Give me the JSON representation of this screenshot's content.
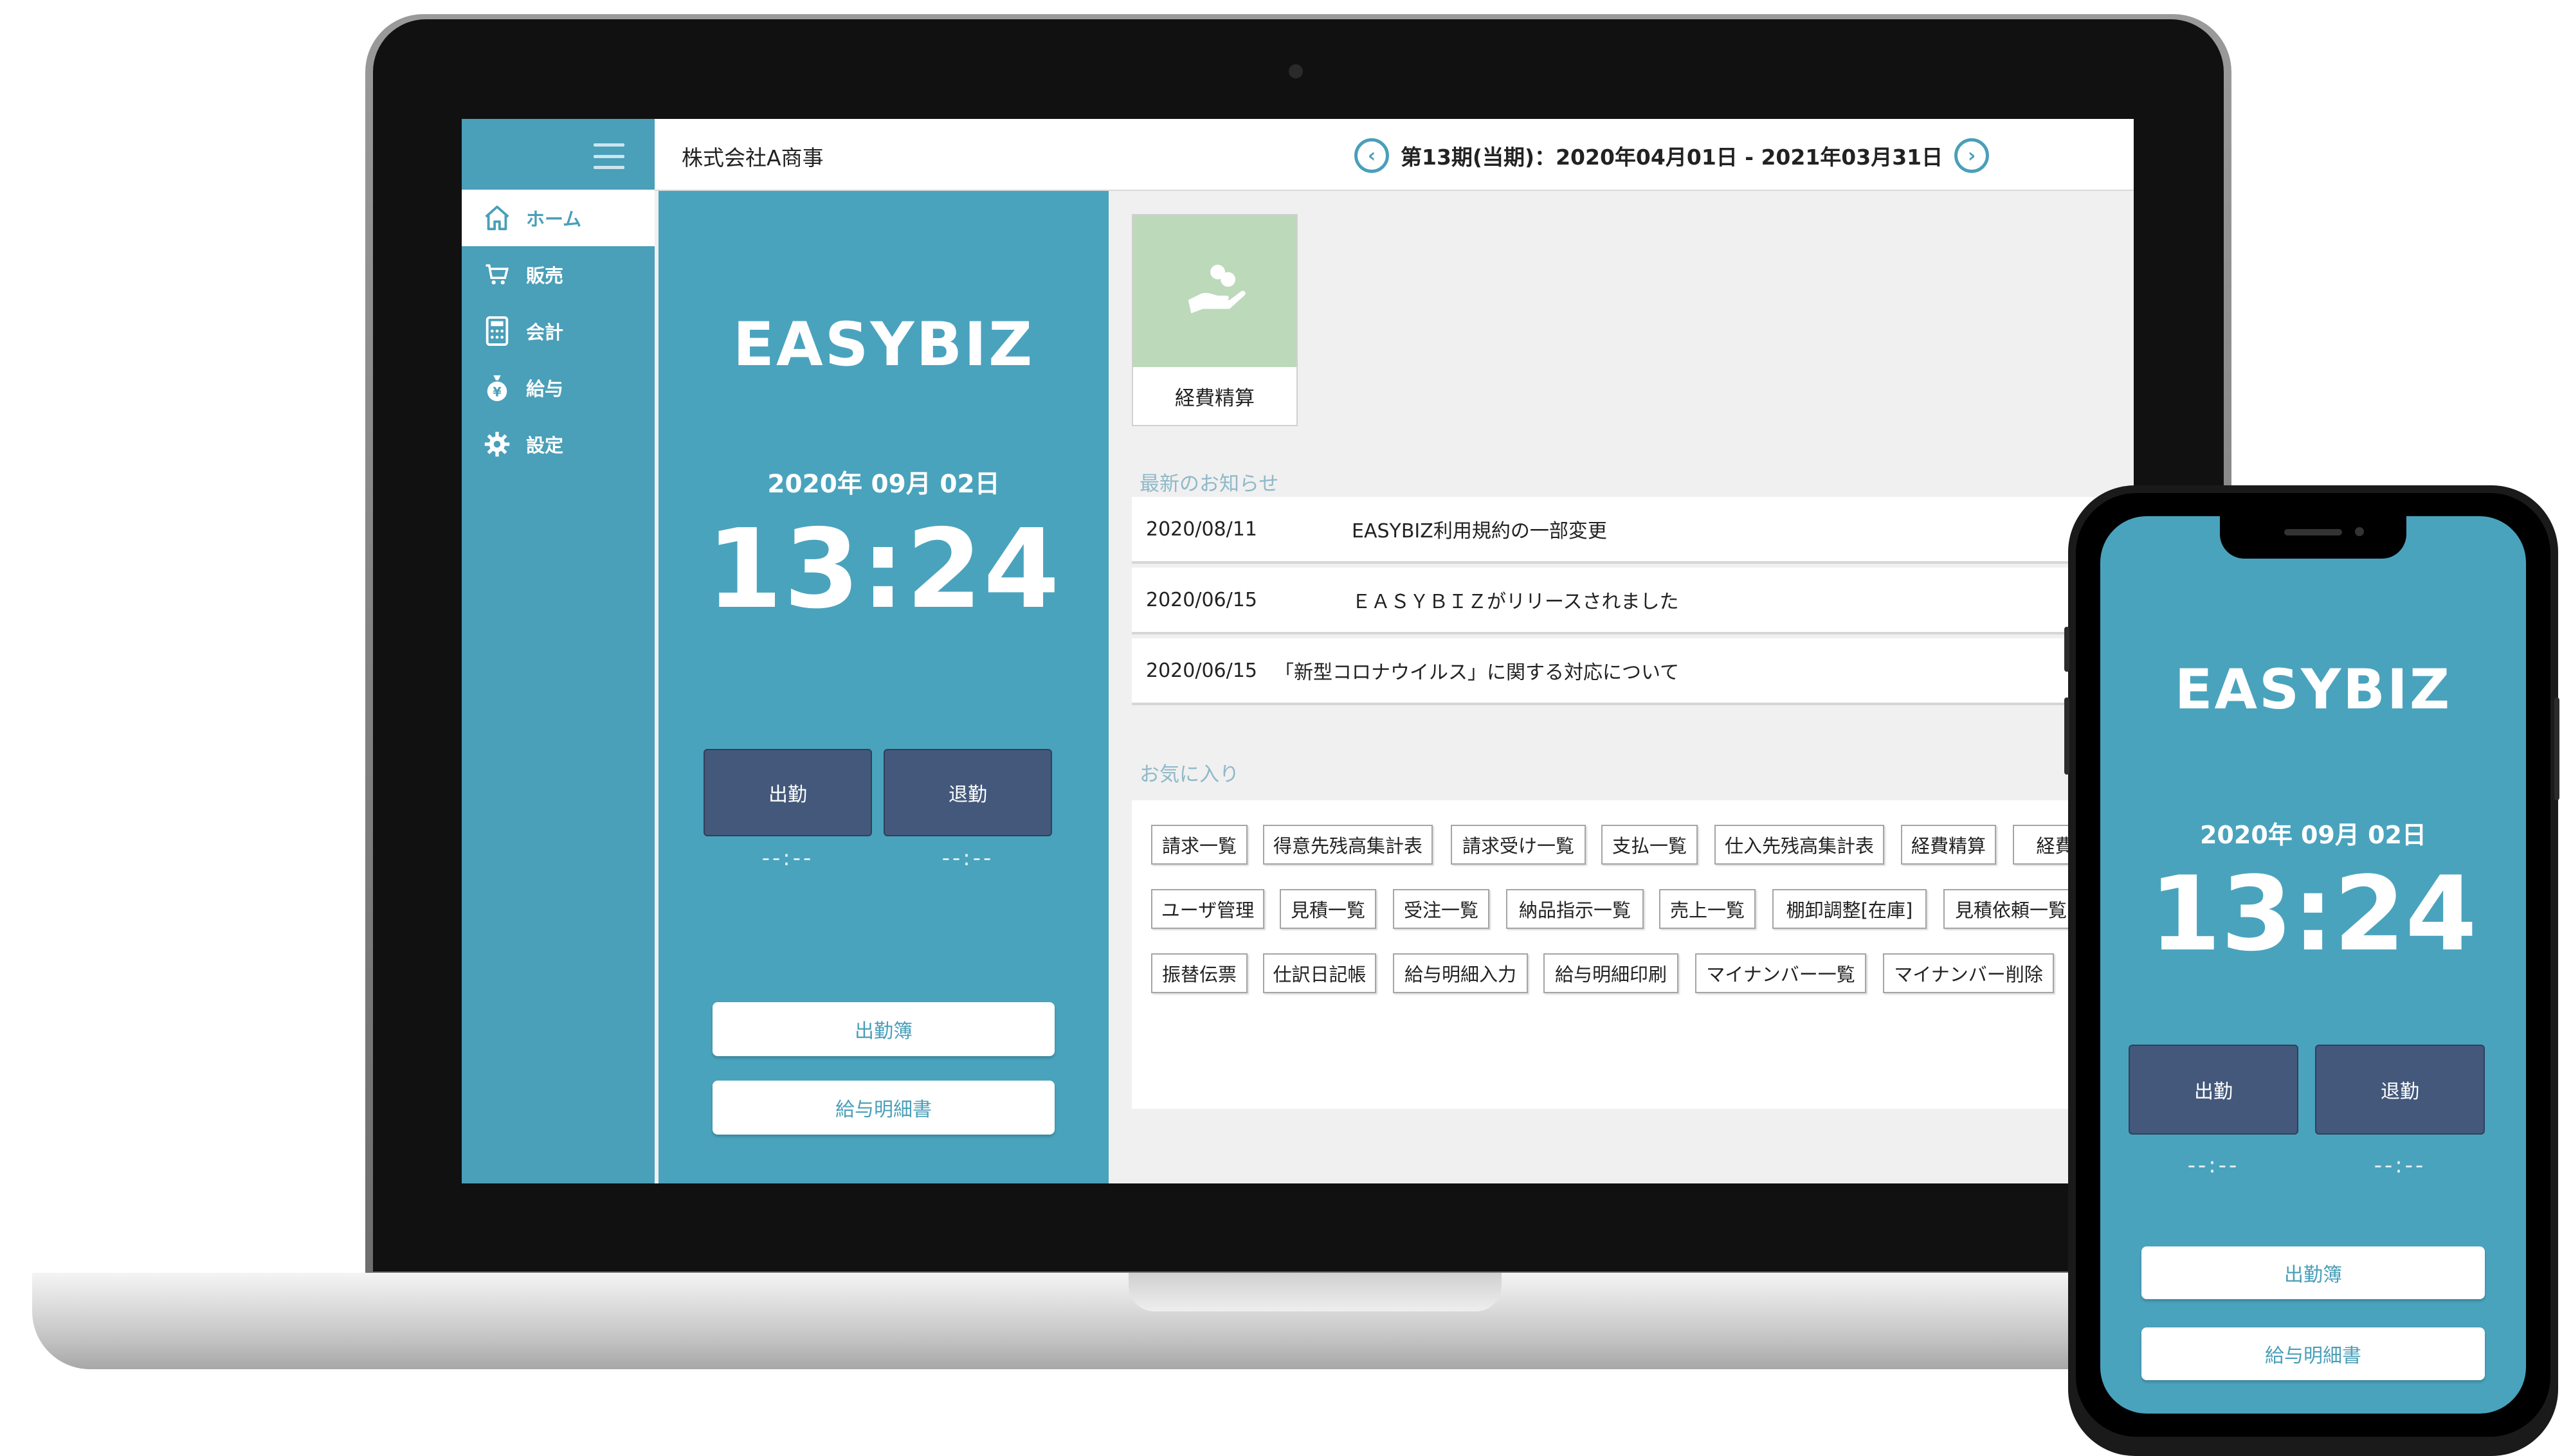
{
  "app": {
    "company": "株式会社A商事",
    "period": "第13期(当期)：2020年04月01日 - 2021年03月31日",
    "prev_icon": "chevron-left-icon",
    "next_icon": "chevron-right-icon"
  },
  "sidebar": {
    "items": [
      {
        "label": "ホーム",
        "icon": "home-icon"
      },
      {
        "label": "販売",
        "icon": "cart-icon"
      },
      {
        "label": "会計",
        "icon": "calculator-icon"
      },
      {
        "label": "給与",
        "icon": "money-bag-icon"
      },
      {
        "label": "設定",
        "icon": "gear-icon"
      }
    ]
  },
  "timecard": {
    "brand": "EASYBIZ",
    "date": "2020年 09月 02日",
    "time": "13:24",
    "clock_in_label": "出勤",
    "clock_out_label": "退勤",
    "clock_in_time": "--:--",
    "clock_out_time": "--:--",
    "attendance_book_label": "出勤簿",
    "payslip_label": "給与明細書"
  },
  "shortcut_tile": {
    "label": "経費精算",
    "icon": "hand-coin-icon"
  },
  "news": {
    "title": "最新のお知らせ",
    "items": [
      {
        "date": "2020/08/11",
        "text": "EASYBIZ利用規約の一部変更"
      },
      {
        "date": "2020/06/15",
        "text": "ＥＡＳＹＢＩＺがリリースされました"
      },
      {
        "date": "2020/06/15",
        "text": "「新型コロナウイルス」に関する対応について"
      }
    ]
  },
  "favorites": {
    "title": "お気に入り",
    "items": [
      "請求一覧",
      "得意先残高集計表",
      "請求受け一覧",
      "支払一覧",
      "仕入先残高集計表",
      "経費精算",
      "経費精",
      "ユーザ管理",
      "見積一覧",
      "受注一覧",
      "納品指示一覧",
      "売上一覧",
      "棚卸調整[在庫]",
      "見積依頼一覧",
      "振替伝票",
      "仕訳日記帳",
      "給与明細入力",
      "給与明細印刷",
      "マイナンバー一覧",
      "マイナンバー削除"
    ]
  },
  "colors": {
    "accent": "#4a9fb9",
    "punch_button": "#43587a",
    "tile_image": "#bcd9b9"
  }
}
